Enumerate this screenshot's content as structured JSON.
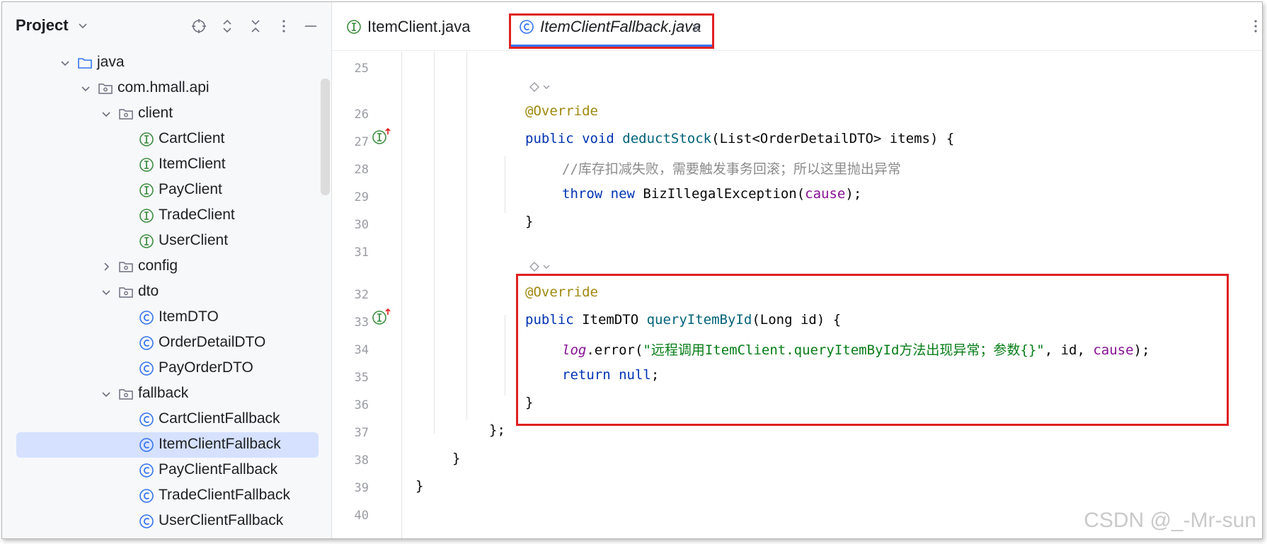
{
  "sidebar": {
    "title": "Project",
    "tree": [
      {
        "label": "java",
        "icon": "folder-icon",
        "chevron": "down"
      },
      {
        "label": "com.hmall.api",
        "icon": "package-icon",
        "chevron": "down"
      },
      {
        "label": "client",
        "icon": "package-icon",
        "chevron": "down"
      },
      {
        "label": "CartClient",
        "icon": "interface-icon"
      },
      {
        "label": "ItemClient",
        "icon": "interface-icon"
      },
      {
        "label": "PayClient",
        "icon": "interface-icon"
      },
      {
        "label": "TradeClient",
        "icon": "interface-icon"
      },
      {
        "label": "UserClient",
        "icon": "interface-icon"
      },
      {
        "label": "config",
        "icon": "package-icon",
        "chevron": "right"
      },
      {
        "label": "dto",
        "icon": "package-icon",
        "chevron": "down"
      },
      {
        "label": "ItemDTO",
        "icon": "class-icon"
      },
      {
        "label": "OrderDetailDTO",
        "icon": "class-icon"
      },
      {
        "label": "PayOrderDTO",
        "icon": "class-icon"
      },
      {
        "label": "fallback",
        "icon": "package-icon",
        "chevron": "down"
      },
      {
        "label": "CartClientFallback",
        "icon": "class-icon"
      },
      {
        "label": "ItemClientFallback",
        "icon": "class-icon",
        "selected": true
      },
      {
        "label": "PayClientFallback",
        "icon": "class-icon"
      },
      {
        "label": "TradeClientFallback",
        "icon": "class-icon"
      },
      {
        "label": "UserClientFallback",
        "icon": "class-icon"
      }
    ]
  },
  "tabs": [
    {
      "label": "ItemClient.java",
      "icon": "interface-icon",
      "active": false
    },
    {
      "label": "ItemClientFallback.java",
      "icon": "class-icon",
      "active": true,
      "close": "×"
    }
  ],
  "editor": {
    "line_numbers": [
      "25",
      "26",
      "27",
      "28",
      "29",
      "30",
      "31",
      "32",
      "33",
      "34",
      "35",
      "36",
      "37",
      "38",
      "39",
      "40"
    ],
    "code": {
      "l26_ann": "@Override",
      "l27_a": "public void ",
      "l27_fn": "deductStock",
      "l27_b": "(List<OrderDetailDTO> items) {",
      "l28": "//库存扣减失败，需要触发事务回滚；所以这里抛出异常",
      "l29_a": "throw new ",
      "l29_b": "BizIllegalException(",
      "l29_par": "cause",
      "l29_c": ");",
      "l30": "}",
      "l32_ann": "@Override",
      "l33_a": "public ",
      "l33_b": "ItemDTO ",
      "l33_fn": "queryItemById",
      "l33_c": "(Long id) {",
      "l34_log": "log",
      "l34_a": ".error(",
      "l34_str": "\"远程调用ItemClient.queryItemById方法出现异常；参数{}\"",
      "l34_b": ", id, ",
      "l34_par": "cause",
      "l34_c": ");",
      "l35_a": "return null",
      "l35_b": ";",
      "l36": "}",
      "l37": "};",
      "l38": "}",
      "l39": "}"
    }
  },
  "watermark": "CSDN @_-Mr-sun",
  "colors": {
    "highlight_box": "#e02020",
    "accent": "#3574f0",
    "selection": "#d5e1ff"
  }
}
